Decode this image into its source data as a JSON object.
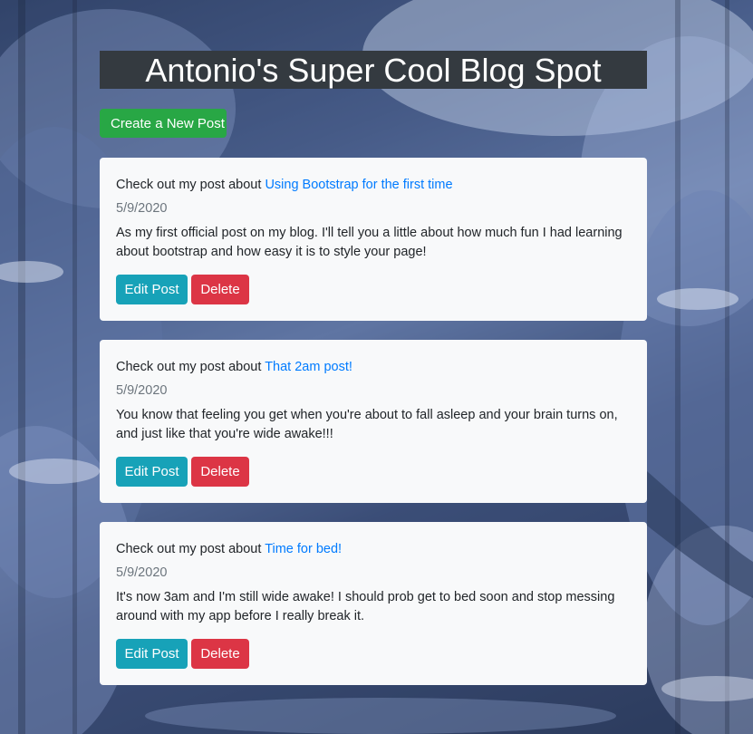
{
  "page": {
    "title": "Antonio's Super Cool Blog Spot",
    "create_button_label": "Create a New Post"
  },
  "posts": [
    {
      "prefix": "Check out my post about",
      "title": "Using Bootstrap for the first time",
      "date": "5/9/2020",
      "body": "As my first official post on my blog. I'll tell you a little about how much fun I had learning about bootstrap and how easy it is to style your page!",
      "edit_label": "Edit Post",
      "delete_label": "Delete"
    },
    {
      "prefix": "Check out my post about",
      "title": "That 2am post!",
      "date": "5/9/2020",
      "body": "You know that feeling you get when you're about to fall asleep and your brain turns on, and just like that you're wide awake!!!",
      "edit_label": "Edit Post",
      "delete_label": "Delete"
    },
    {
      "prefix": "Check out my post about",
      "title": "Time for bed!",
      "date": "5/9/2020",
      "body": "It's now 3am and I'm still wide awake! I should prob get to bed soon and stop messing around with my app before I really break it.",
      "edit_label": "Edit Post",
      "delete_label": "Delete"
    }
  ],
  "colors": {
    "title_bar": "#343a40",
    "create_button": "#28a745",
    "edit_button": "#17a2b8",
    "delete_button": "#dc3545",
    "link": "#007bff",
    "card": "#f8f9fa"
  }
}
